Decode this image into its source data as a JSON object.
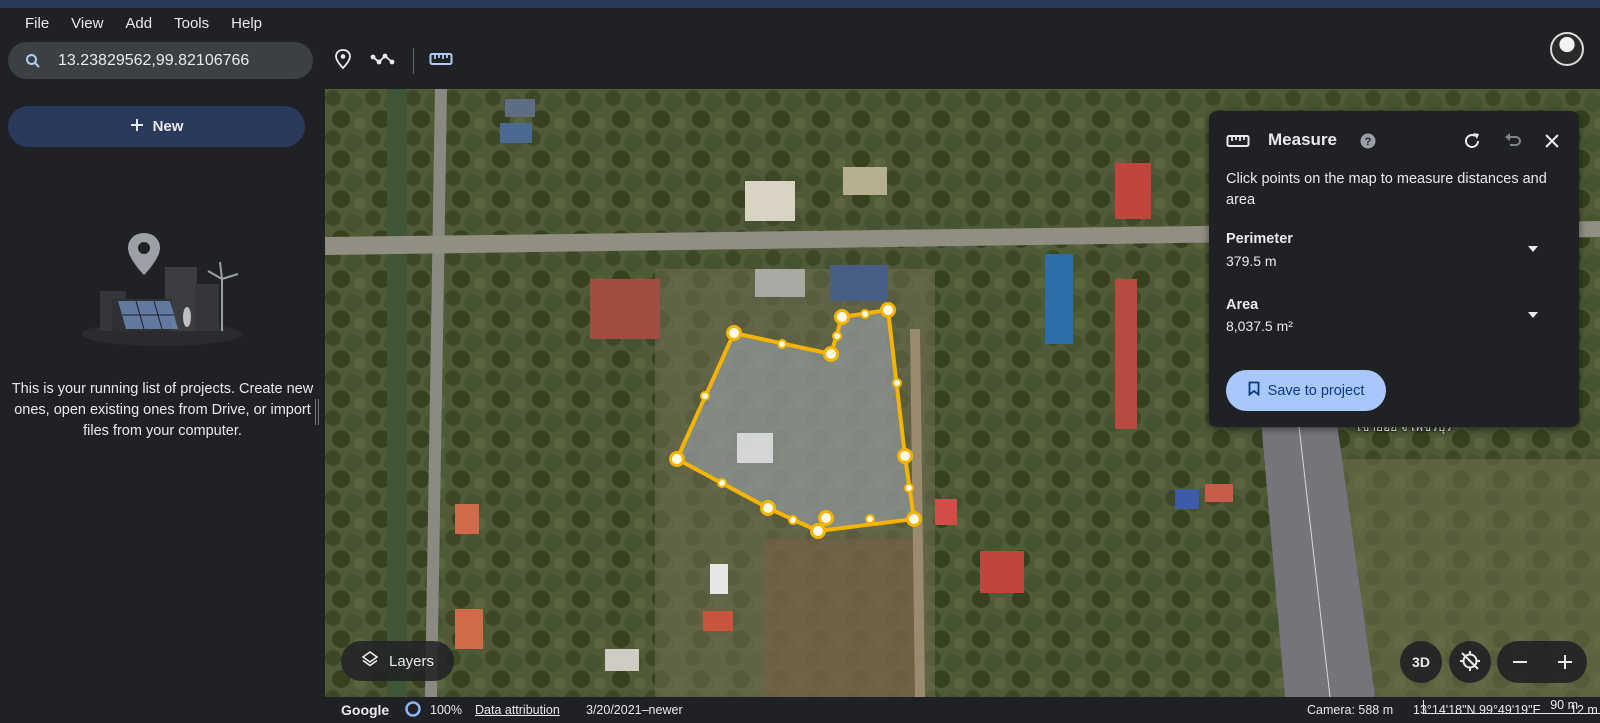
{
  "menu": [
    "File",
    "View",
    "Add",
    "Tools",
    "Help"
  ],
  "search": {
    "value": "13.23829562,99.82106766"
  },
  "toolbar": {
    "icons": [
      "search-icon",
      "placemark-icon",
      "path-icon",
      "ruler-icon"
    ]
  },
  "sidebar": {
    "new_label": "New",
    "empty_text": "This is your running list of projects. Create new ones, open existing ones from Drive, or import files from your computer."
  },
  "map": {
    "road_label": "เขาย้อย จ เพชรบุรี",
    "layers_label": "Layers",
    "btn_3d": "3D"
  },
  "measure": {
    "title": "Measure",
    "description": "Click points on the map to measure distances and area",
    "perimeter_label": "Perimeter",
    "perimeter_value": "379.5 m",
    "area_label": "Area",
    "area_value": "8,037.5 m²",
    "save_label": "Save to project"
  },
  "status": {
    "logo": "Google",
    "loading_percent": "100%",
    "attribution": "Data attribution",
    "imagery_date": "3/20/2021–newer",
    "scale": "90 m",
    "camera": "Camera: 588 m",
    "coords": "13°14'18\"N 99°49'19\"E",
    "elevation": "12 m"
  },
  "colors": {
    "accent": "#a8c7fa",
    "measure_line": "#f4b400",
    "panel_bg": "#202124",
    "new_button_bg": "#2b3a5c"
  }
}
